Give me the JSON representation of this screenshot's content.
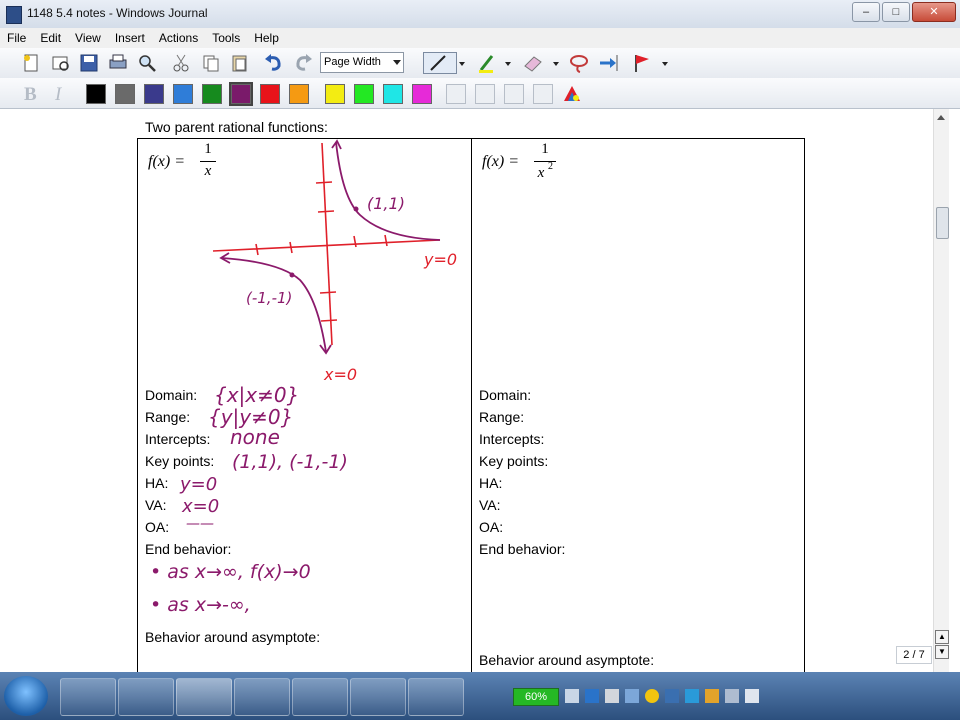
{
  "window": {
    "title": "1148 5.4 notes - Windows Journal",
    "minimize": "–",
    "maximize": "□",
    "close": "✕"
  },
  "menu": [
    "File",
    "Edit",
    "View",
    "Insert",
    "Actions",
    "Tools",
    "Help"
  ],
  "toolbar": {
    "zoom_value": "Page Width"
  },
  "palette": [
    "#000000",
    "#6a6a6a",
    "#3a3a8c",
    "#2f7dd8",
    "#168a1e",
    "#7a1a6a",
    "#e8131a",
    "#f59a12",
    "#f3ec12",
    "#23e823",
    "#1fe6e6",
    "#e62ad8"
  ],
  "document": {
    "title": "Two parent rational functions:",
    "left": {
      "formula_lhs": "f(x) =",
      "numerator": "1",
      "denominator": "x",
      "labels": {
        "domain": "Domain:",
        "range": "Range:",
        "intercepts": "Intercepts:",
        "key_points": "Key points:",
        "ha": "HA:",
        "va": "VA:",
        "oa": "OA:",
        "end_behavior": "End behavior:",
        "behavior_asymptote": "Behavior around asymptote:"
      },
      "handwriting": {
        "domain": "{x|x≠0}",
        "range": "{y|y≠0}",
        "intercepts": "none",
        "key_points": "(1,1), (-1,-1)",
        "ha": "y=0",
        "va": "x=0",
        "oa": "——",
        "end1": "• as x→∞, f(x)→0",
        "end2": "• as x→-∞,",
        "graph_pt1": "(1,1)",
        "graph_pt2": "(-1,-1)",
        "ha_label": "y=0",
        "va_label": "x=0"
      }
    },
    "right": {
      "formula_lhs": "f(x) =",
      "numerator": "1",
      "denominator": "x",
      "exponent": "2",
      "labels": {
        "domain": "Domain:",
        "range": "Range:",
        "intercepts": "Intercepts:",
        "key_points": "Key points:",
        "ha": "HA:",
        "va": "VA:",
        "oa": "OA:",
        "end_behavior": "End behavior:",
        "behavior_asymptote": "Behavior around asymptote:"
      }
    }
  },
  "page_indicator": "2 / 7",
  "tray": {
    "battery": "60%",
    "ink_color": "#8b1a6b",
    "red_ink": "#e0202a"
  }
}
